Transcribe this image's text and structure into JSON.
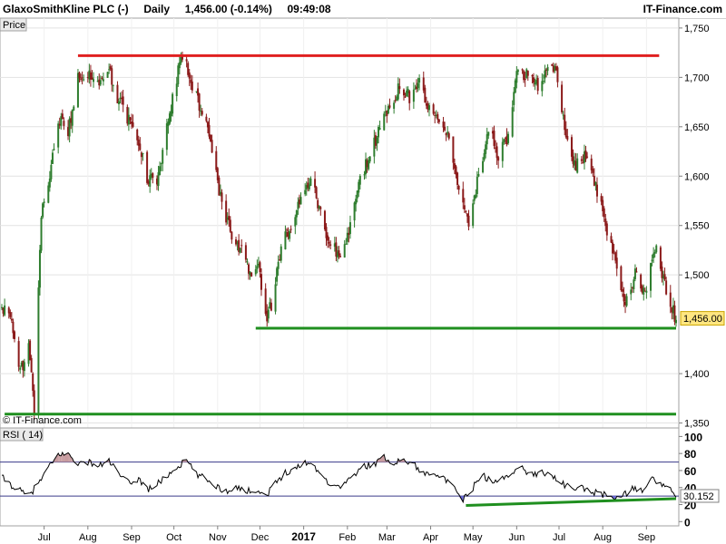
{
  "header": {
    "instrument": "GlaxoSmithKline PLC (-)",
    "period": "Daily",
    "quote": "1,456.00 (-0.14%)",
    "time": "09:49:08",
    "brand": "IT-Finance.com"
  },
  "price_panel": {
    "label": "Price",
    "watermark": "© IT-Finance.com",
    "last_price_label": "1,456.00"
  },
  "rsi_panel": {
    "label": "RSI ( 14)",
    "last_value_label": "30.152"
  },
  "colors": {
    "candle_up": "#2e7d2e",
    "candle_down": "#8b1a1a",
    "resistance": "#e02020",
    "support": "#1f8f1f",
    "rsi_line": "#000000",
    "rsi_overbought_fill": "#c89ca0",
    "rsi_oversold_fill": "#6a6adc",
    "last_price_badge": "#ffe680"
  },
  "chart_data": [
    {
      "type": "candlestick",
      "title": "GlaxoSmithKline PLC (-)",
      "ylabel": "Price",
      "ylim": [
        1345,
        1760
      ],
      "y_ticks": [
        {
          "value": 1750,
          "label": "1,750"
        },
        {
          "value": 1700,
          "label": "1,700"
        },
        {
          "value": 1650,
          "label": "1,650"
        },
        {
          "value": 1600,
          "label": "1,600"
        },
        {
          "value": 1550,
          "label": "1,550"
        },
        {
          "value": 1500,
          "label": "1,500"
        },
        {
          "value": 1400,
          "label": "1,400"
        },
        {
          "value": 1350,
          "label": "1,350"
        }
      ],
      "x_range": [
        "2016-06-01",
        "2017-09-22"
      ],
      "x_ticks": [
        {
          "date": "2016-07-01",
          "label": "Jul",
          "bold": false
        },
        {
          "date": "2016-08-01",
          "label": "Aug",
          "bold": false
        },
        {
          "date": "2016-09-01",
          "label": "Sep",
          "bold": false
        },
        {
          "date": "2016-10-01",
          "label": "Oct",
          "bold": false
        },
        {
          "date": "2016-11-01",
          "label": "Nov",
          "bold": false
        },
        {
          "date": "2016-12-01",
          "label": "Dec",
          "bold": false
        },
        {
          "date": "2017-01-01",
          "label": "2017",
          "bold": true
        },
        {
          "date": "2017-02-01",
          "label": "Feb",
          "bold": false
        },
        {
          "date": "2017-03-01",
          "label": "Mar",
          "bold": false
        },
        {
          "date": "2017-04-01",
          "label": "Apr",
          "bold": false
        },
        {
          "date": "2017-05-01",
          "label": "May",
          "bold": false
        },
        {
          "date": "2017-06-01",
          "label": "Jun",
          "bold": false
        },
        {
          "date": "2017-07-01",
          "label": "Jul",
          "bold": false
        },
        {
          "date": "2017-08-01",
          "label": "Aug",
          "bold": false
        },
        {
          "date": "2017-09-01",
          "label": "Sep",
          "bold": false
        }
      ],
      "price_path": [
        [
          "2016-06-01",
          1470
        ],
        [
          "2016-06-08",
          1450
        ],
        [
          "2016-06-14",
          1400
        ],
        [
          "2016-06-20",
          1430
        ],
        [
          "2016-06-24",
          1365
        ],
        [
          "2016-06-29",
          1560
        ],
        [
          "2016-07-05",
          1600
        ],
        [
          "2016-07-11",
          1660
        ],
        [
          "2016-07-18",
          1645
        ],
        [
          "2016-07-25",
          1700
        ],
        [
          "2016-08-01",
          1705
        ],
        [
          "2016-08-08",
          1690
        ],
        [
          "2016-08-15",
          1710
        ],
        [
          "2016-08-22",
          1680
        ],
        [
          "2016-08-29",
          1660
        ],
        [
          "2016-09-05",
          1640
        ],
        [
          "2016-09-12",
          1600
        ],
        [
          "2016-09-19",
          1590
        ],
        [
          "2016-09-26",
          1650
        ],
        [
          "2016-10-03",
          1700
        ],
        [
          "2016-10-07",
          1725
        ],
        [
          "2016-10-14",
          1690
        ],
        [
          "2016-10-21",
          1665
        ],
        [
          "2016-10-28",
          1630
        ],
        [
          "2016-11-04",
          1570
        ],
        [
          "2016-11-11",
          1540
        ],
        [
          "2016-11-18",
          1525
        ],
        [
          "2016-11-25",
          1500
        ],
        [
          "2016-11-30",
          1515
        ],
        [
          "2016-12-05",
          1455
        ],
        [
          "2016-12-09",
          1470
        ],
        [
          "2016-12-16",
          1530
        ],
        [
          "2016-12-23",
          1550
        ],
        [
          "2016-12-30",
          1580
        ],
        [
          "2017-01-06",
          1600
        ],
        [
          "2017-01-13",
          1560
        ],
        [
          "2017-01-20",
          1530
        ],
        [
          "2017-01-27",
          1520
        ],
        [
          "2017-02-03",
          1550
        ],
        [
          "2017-02-10",
          1600
        ],
        [
          "2017-02-17",
          1620
        ],
        [
          "2017-02-24",
          1650
        ],
        [
          "2017-03-03",
          1670
        ],
        [
          "2017-03-10",
          1690
        ],
        [
          "2017-03-17",
          1680
        ],
        [
          "2017-03-24",
          1695
        ],
        [
          "2017-03-31",
          1670
        ],
        [
          "2017-04-07",
          1660
        ],
        [
          "2017-04-14",
          1640
        ],
        [
          "2017-04-21",
          1580
        ],
        [
          "2017-04-28",
          1555
        ],
        [
          "2017-05-05",
          1600
        ],
        [
          "2017-05-12",
          1650
        ],
        [
          "2017-05-19",
          1620
        ],
        [
          "2017-05-26",
          1640
        ],
        [
          "2017-06-02",
          1710
        ],
        [
          "2017-06-09",
          1700
        ],
        [
          "2017-06-16",
          1690
        ],
        [
          "2017-06-23",
          1705
        ],
        [
          "2017-06-29",
          1710
        ],
        [
          "2017-07-06",
          1640
        ],
        [
          "2017-07-13",
          1610
        ],
        [
          "2017-07-20",
          1620
        ],
        [
          "2017-07-27",
          1590
        ],
        [
          "2017-08-03",
          1550
        ],
        [
          "2017-08-10",
          1520
        ],
        [
          "2017-08-17",
          1470
        ],
        [
          "2017-08-24",
          1500
        ],
        [
          "2017-08-31",
          1480
        ],
        [
          "2017-09-07",
          1530
        ],
        [
          "2017-09-12",
          1500
        ],
        [
          "2017-09-18",
          1470
        ],
        [
          "2017-09-22",
          1456
        ]
      ],
      "trend_lines": [
        {
          "name": "resistance",
          "start": [
            "2016-07-25",
            1722
          ],
          "end": [
            "2017-09-10",
            1722
          ]
        },
        {
          "name": "support-upper",
          "start": [
            "2016-11-28",
            1446
          ],
          "end": [
            "2017-09-22",
            1446
          ]
        },
        {
          "name": "support-lower",
          "start": [
            "2016-06-03",
            1359
          ],
          "end": [
            "2017-09-22",
            1359
          ]
        }
      ],
      "last_price": 1456.0
    },
    {
      "type": "line",
      "title": "RSI ( 14)",
      "ylim": [
        -5,
        110
      ],
      "y_ticks": [
        {
          "value": 100,
          "label": "100"
        },
        {
          "value": 80,
          "label": "80"
        },
        {
          "value": 60,
          "label": "60"
        },
        {
          "value": 40,
          "label": "40"
        },
        {
          "value": 20,
          "label": "20"
        },
        {
          "value": 0,
          "label": "0"
        }
      ],
      "levels": [
        70,
        30
      ],
      "rsi_path": [
        [
          "2016-06-01",
          52
        ],
        [
          "2016-06-10",
          40
        ],
        [
          "2016-06-20",
          30
        ],
        [
          "2016-06-27",
          45
        ],
        [
          "2016-07-05",
          65
        ],
        [
          "2016-07-12",
          80
        ],
        [
          "2016-07-19",
          78
        ],
        [
          "2016-07-26",
          68
        ],
        [
          "2016-08-02",
          70
        ],
        [
          "2016-08-09",
          65
        ],
        [
          "2016-08-16",
          72
        ],
        [
          "2016-08-23",
          55
        ],
        [
          "2016-08-30",
          45
        ],
        [
          "2016-09-06",
          50
        ],
        [
          "2016-09-13",
          38
        ],
        [
          "2016-09-20",
          45
        ],
        [
          "2016-09-27",
          55
        ],
        [
          "2016-10-04",
          65
        ],
        [
          "2016-10-10",
          72
        ],
        [
          "2016-10-17",
          55
        ],
        [
          "2016-10-24",
          50
        ],
        [
          "2016-10-31",
          42
        ],
        [
          "2016-11-07",
          35
        ],
        [
          "2016-11-14",
          42
        ],
        [
          "2016-11-21",
          35
        ],
        [
          "2016-11-28",
          38
        ],
        [
          "2016-12-05",
          30
        ],
        [
          "2016-12-12",
          45
        ],
        [
          "2016-12-19",
          58
        ],
        [
          "2016-12-26",
          62
        ],
        [
          "2017-01-02",
          70
        ],
        [
          "2017-01-09",
          65
        ],
        [
          "2017-01-16",
          50
        ],
        [
          "2017-01-23",
          40
        ],
        [
          "2017-01-30",
          45
        ],
        [
          "2017-02-06",
          55
        ],
        [
          "2017-02-13",
          65
        ],
        [
          "2017-02-20",
          68
        ],
        [
          "2017-02-27",
          75
        ],
        [
          "2017-03-06",
          70
        ],
        [
          "2017-03-13",
          72
        ],
        [
          "2017-03-20",
          68
        ],
        [
          "2017-03-27",
          55
        ],
        [
          "2017-04-03",
          60
        ],
        [
          "2017-04-10",
          50
        ],
        [
          "2017-04-17",
          40
        ],
        [
          "2017-04-24",
          25
        ],
        [
          "2017-05-01",
          40
        ],
        [
          "2017-05-08",
          55
        ],
        [
          "2017-05-15",
          45
        ],
        [
          "2017-05-22",
          50
        ],
        [
          "2017-05-29",
          60
        ],
        [
          "2017-06-05",
          62
        ],
        [
          "2017-06-12",
          55
        ],
        [
          "2017-06-19",
          58
        ],
        [
          "2017-06-26",
          55
        ],
        [
          "2017-07-03",
          45
        ],
        [
          "2017-07-10",
          38
        ],
        [
          "2017-07-17",
          40
        ],
        [
          "2017-07-24",
          35
        ],
        [
          "2017-07-31",
          32
        ],
        [
          "2017-08-07",
          30
        ],
        [
          "2017-08-14",
          28
        ],
        [
          "2017-08-21",
          38
        ],
        [
          "2017-08-28",
          36
        ],
        [
          "2017-09-04",
          50
        ],
        [
          "2017-09-11",
          45
        ],
        [
          "2017-09-18",
          36
        ],
        [
          "2017-09-22",
          30.152
        ]
      ],
      "trend_line": {
        "start": [
          "2017-04-26",
          19
        ],
        "end": [
          "2017-09-22",
          27
        ]
      },
      "last_value": 30.152
    }
  ]
}
